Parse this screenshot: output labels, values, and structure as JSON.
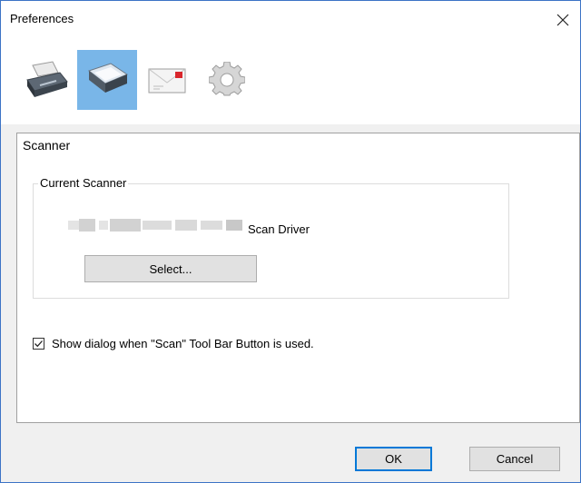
{
  "window": {
    "title": "Preferences",
    "close_symbol": "×"
  },
  "toolbar": {
    "items": [
      {
        "icon": "printer-icon",
        "active": false
      },
      {
        "icon": "scanner-icon",
        "active": true
      },
      {
        "icon": "envelope-icon",
        "active": false
      },
      {
        "icon": "gear-icon",
        "active": false
      }
    ],
    "active_color": "#79b6e8"
  },
  "panel": {
    "title": "Scanner",
    "group": {
      "legend": "Current Scanner",
      "driver_label": "Scan Driver",
      "select_label": "Select..."
    },
    "checkbox": {
      "checked": true,
      "label": "Show dialog when \"Scan\" Tool Bar Button is used."
    }
  },
  "buttons": {
    "ok": "OK",
    "cancel": "Cancel"
  }
}
